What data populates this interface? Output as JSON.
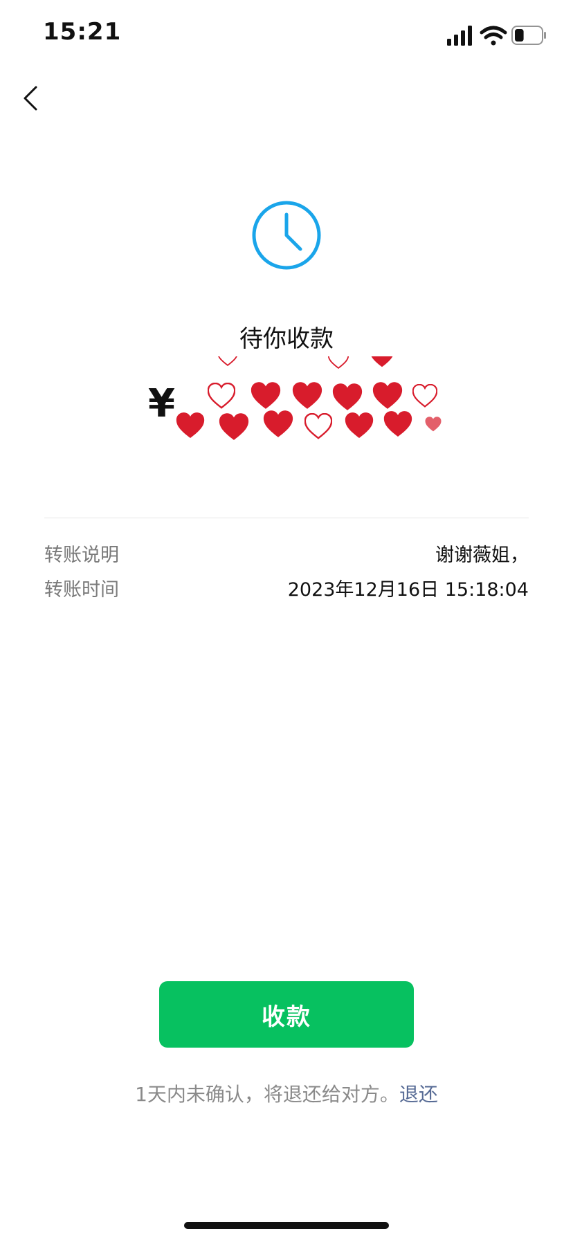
{
  "status_bar": {
    "time": "15:21",
    "icons": [
      "signal-icon",
      "wifi-icon",
      "battery-icon"
    ],
    "battery_level": 0.35
  },
  "nav": {
    "back_icon": "chevron-left-icon"
  },
  "status_icon": "clock-icon",
  "title": "待你收款",
  "amount": {
    "currency_symbol": "¥",
    "value_obscured_by": "red-hearts-sticker"
  },
  "details": [
    {
      "label": "转账说明",
      "value": "谢谢薇姐，"
    },
    {
      "label": "转账时间",
      "value": "2023年12月16日 15:18:04"
    }
  ],
  "actions": {
    "collect_label": "收款",
    "note_text": "1天内未确认，将退还给对方。",
    "refund_link": "退还"
  },
  "colors": {
    "accent_green": "#07c160",
    "clock_blue": "#1aa5ea",
    "link_blue": "#576b95",
    "heart_red": "#d81c2c"
  }
}
